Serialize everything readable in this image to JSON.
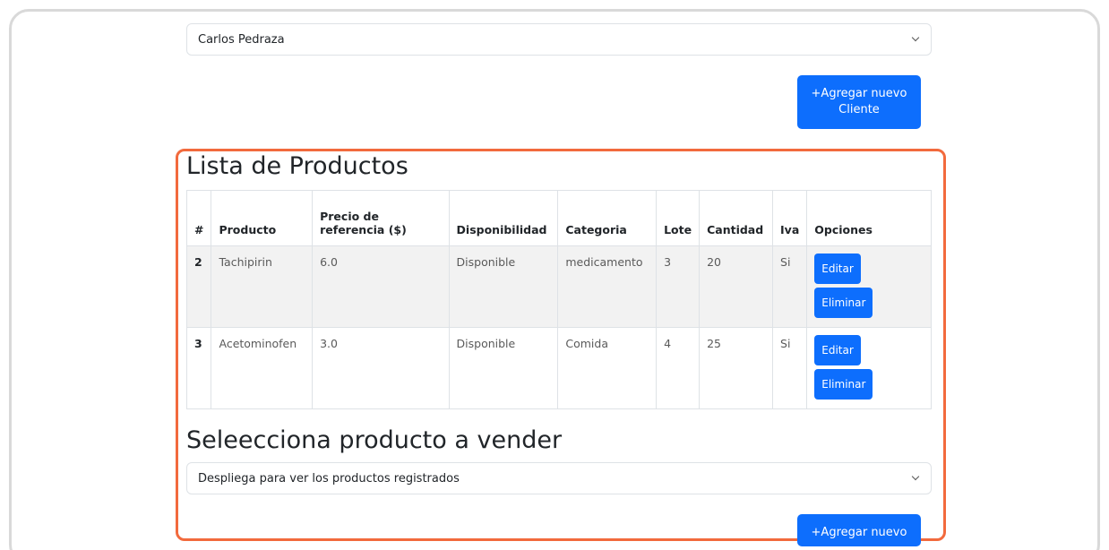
{
  "client_select": {
    "value": "Carlos Pedraza"
  },
  "add_client_button": {
    "line1": "+Agregar nuevo",
    "line2": "Cliente"
  },
  "products_section": {
    "title": "Lista de Productos",
    "columns": [
      "#",
      "Producto",
      "Precio de referencia ($)",
      "Disponibilidad",
      "Categoria",
      "Lote",
      "Cantidad",
      "Iva",
      "Opciones"
    ],
    "rows": [
      {
        "id": "2",
        "producto": "Tachipirin",
        "precio": "6.0",
        "disponibilidad": "Disponible",
        "categoria": "medicamento",
        "lote": "3",
        "cantidad": "20",
        "iva": "Si",
        "edit_label": "Editar",
        "delete_label": "Eliminar"
      },
      {
        "id": "3",
        "producto": "Acetominofen",
        "precio": "3.0",
        "disponibilidad": "Disponible",
        "categoria": "Comida",
        "lote": "4",
        "cantidad": "25",
        "iva": "Si",
        "edit_label": "Editar",
        "delete_label": "Eliminar"
      }
    ]
  },
  "sell_section": {
    "title": "Seleecciona producto a vender",
    "select_placeholder": "Despliega para ver los productos registrados"
  },
  "add_product_button": {
    "label": "+Agregar nuevo"
  },
  "colors": {
    "primary": "#0d6efd",
    "highlight": "#f26a3d"
  }
}
